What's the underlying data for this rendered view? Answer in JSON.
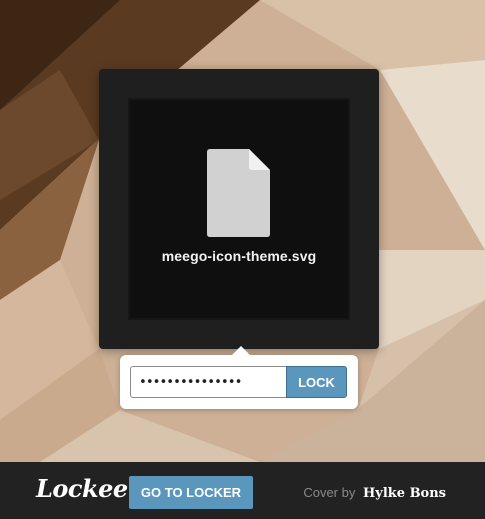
{
  "colors": {
    "accent": "#5b97bd",
    "footer_background": "#222222",
    "card_background": "#1f1f1f",
    "file_icon": "#d1d1d1"
  },
  "file_card": {
    "icon": "file-icon",
    "file_name": "meego-icon-theme.svg"
  },
  "lock_form": {
    "password_value": "•••••••••••••••",
    "lock_label": "LOCK"
  },
  "footer": {
    "logo_text": "Lockee",
    "goto_label": "GO TO LOCKER",
    "cover_prefix": "Cover by",
    "cover_author": "Hylke Bons"
  }
}
